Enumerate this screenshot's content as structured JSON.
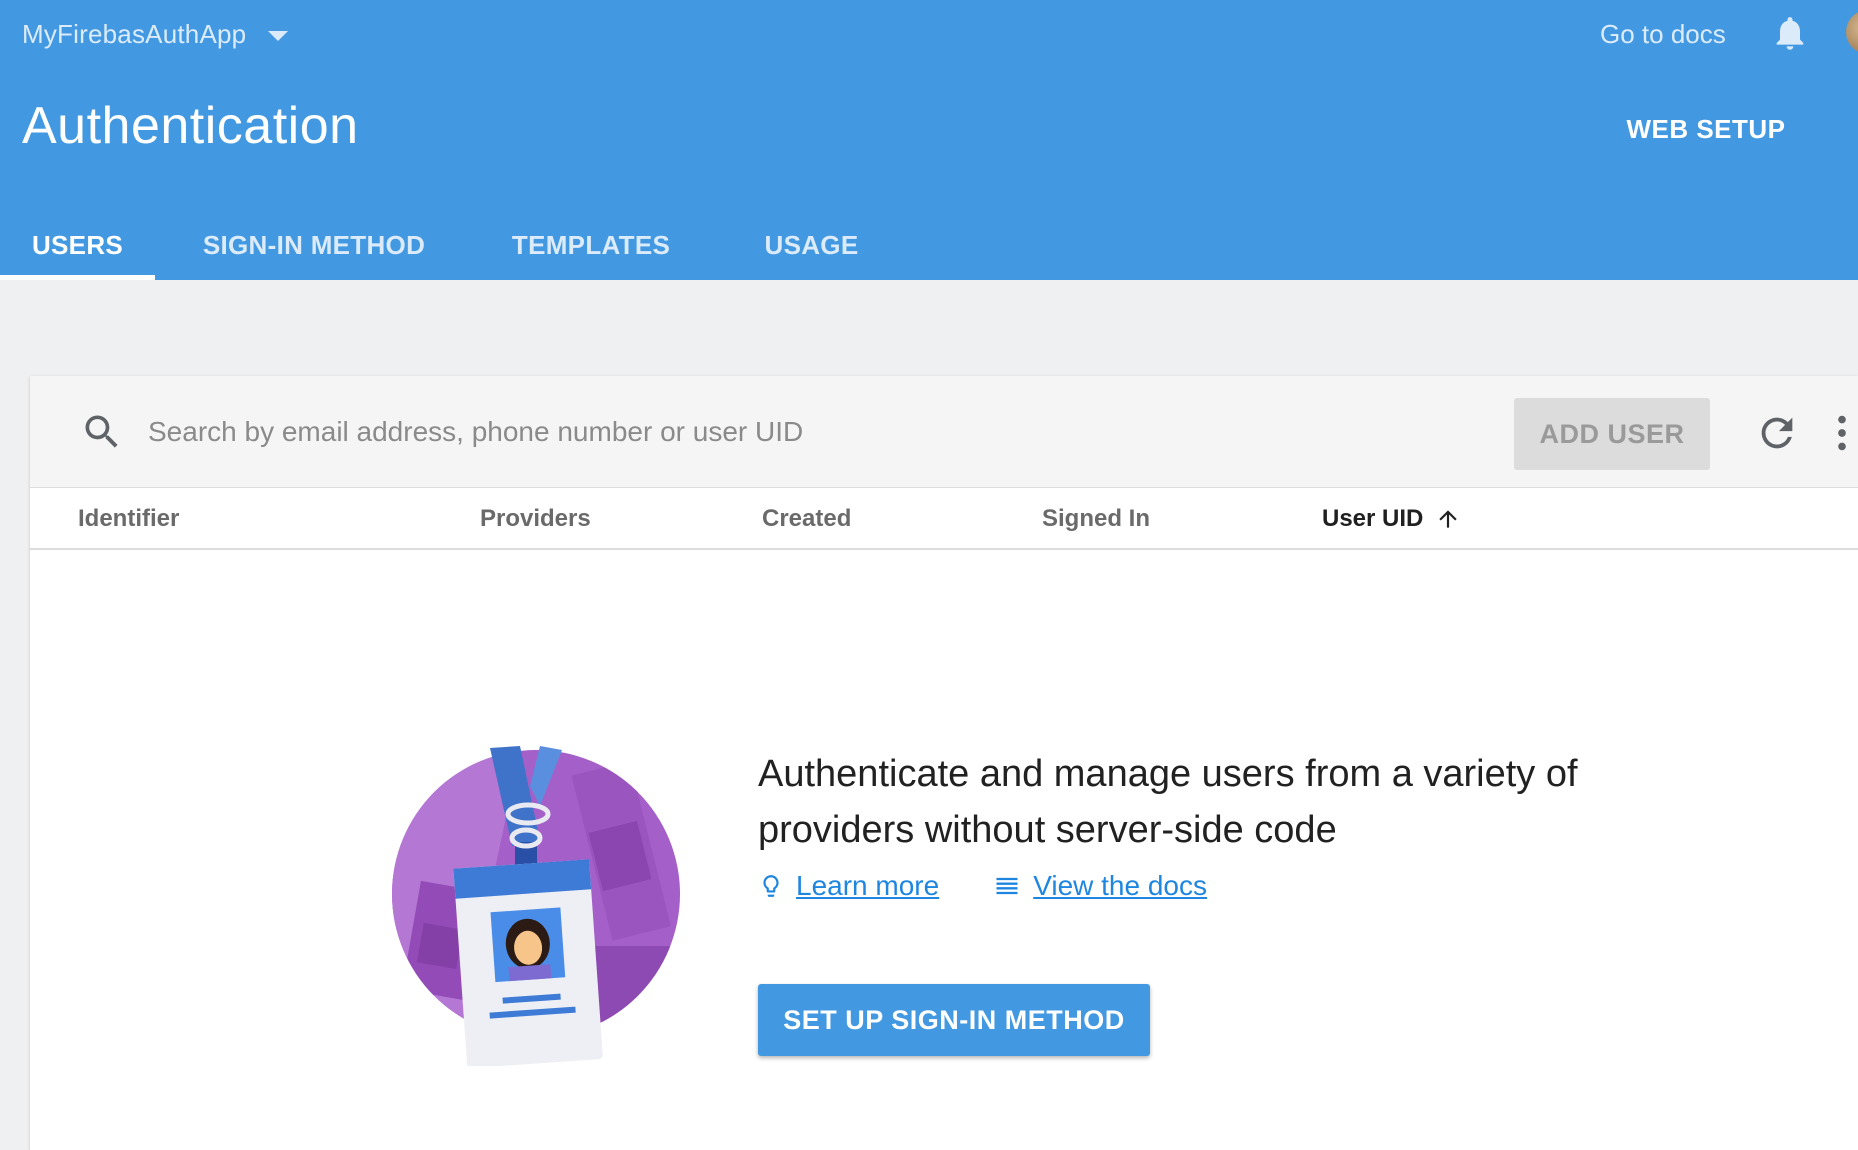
{
  "app": {
    "project_name": "MyFirebasAuthApp",
    "docs_link": "Go to docs",
    "brand_color": "#4299e1"
  },
  "page": {
    "title": "Authentication",
    "web_setup_label": "WEB SETUP"
  },
  "tabs": [
    {
      "label": "USERS",
      "active": true
    },
    {
      "label": "SIGN-IN METHOD",
      "active": false
    },
    {
      "label": "TEMPLATES",
      "active": false
    },
    {
      "label": "USAGE",
      "active": false
    }
  ],
  "toolbar": {
    "search_placeholder": "Search by email address, phone number or user UID",
    "add_user_label": "ADD USER"
  },
  "table": {
    "columns": [
      "Identifier",
      "Providers",
      "Created",
      "Signed In",
      "User UID"
    ],
    "sorted_column": "User UID",
    "sort_direction": "ascending"
  },
  "empty_state": {
    "headline": "Authenticate and manage users from a variety of providers without server-side code",
    "learn_more": "Learn more",
    "view_docs": "View the docs",
    "cta_label": "SET UP SIGN-IN METHOD"
  },
  "icons": [
    "chevron-down-icon",
    "bell-icon",
    "search-icon",
    "refresh-icon",
    "more-vert-icon",
    "arrow-up-icon",
    "lightbulb-icon",
    "docs-list-icon"
  ]
}
